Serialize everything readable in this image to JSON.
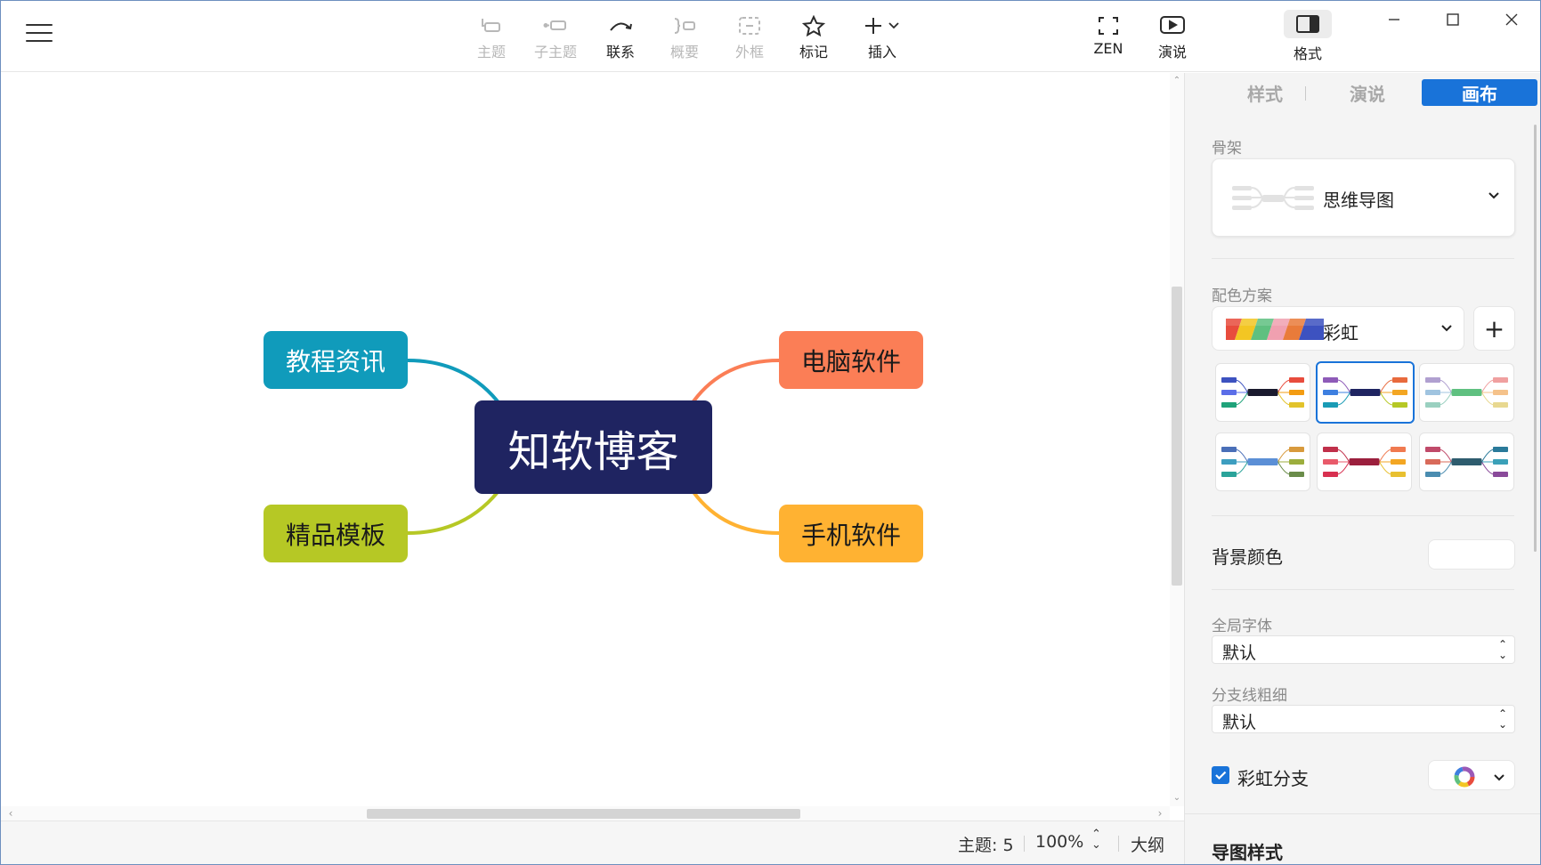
{
  "toolbar": {
    "tools": [
      {
        "label": "主题",
        "enabled": false,
        "icon": "topic-icon"
      },
      {
        "label": "子主题",
        "enabled": false,
        "icon": "subtopic-icon"
      },
      {
        "label": "联系",
        "enabled": true,
        "icon": "relationship-icon"
      },
      {
        "label": "概要",
        "enabled": false,
        "icon": "summary-icon"
      },
      {
        "label": "外框",
        "enabled": false,
        "icon": "boundary-icon"
      },
      {
        "label": "标记",
        "enabled": true,
        "icon": "star-icon"
      },
      {
        "label": "插入",
        "enabled": true,
        "icon": "plus-icon"
      }
    ],
    "zen_label": "ZEN",
    "present_label": "演说",
    "format_label": "格式"
  },
  "mindmap": {
    "central": "知软博客",
    "branches": [
      {
        "label": "教程资讯",
        "color": "#109bbb"
      },
      {
        "label": "电脑软件",
        "color": "#fb7e56"
      },
      {
        "label": "精品模板",
        "color": "#b6c825"
      },
      {
        "label": "手机软件",
        "color": "#ffb232"
      }
    ],
    "central_color": "#1f2461"
  },
  "status": {
    "topic_count": "主题: 5",
    "zoom": "100%",
    "outline": "大纲"
  },
  "panel": {
    "tabs": [
      {
        "label": "样式",
        "active": false
      },
      {
        "label": "演说",
        "active": false
      },
      {
        "label": "画布",
        "active": true
      }
    ],
    "skeleton": {
      "label": "骨架",
      "value": "思维导图"
    },
    "palette": {
      "label": "配色方案",
      "value": "彩虹",
      "add": "+"
    },
    "background": {
      "label": "背景颜色",
      "value": "#ffffff"
    },
    "global_font": {
      "label": "全局字体",
      "value": "默认"
    },
    "branch_width": {
      "label": "分支线粗细",
      "value": "默认"
    },
    "rainbow_branch": {
      "label": "彩虹分支",
      "checked": true
    },
    "map_style_title": "导图样式"
  },
  "colors": {
    "accent": "#1973d9"
  }
}
